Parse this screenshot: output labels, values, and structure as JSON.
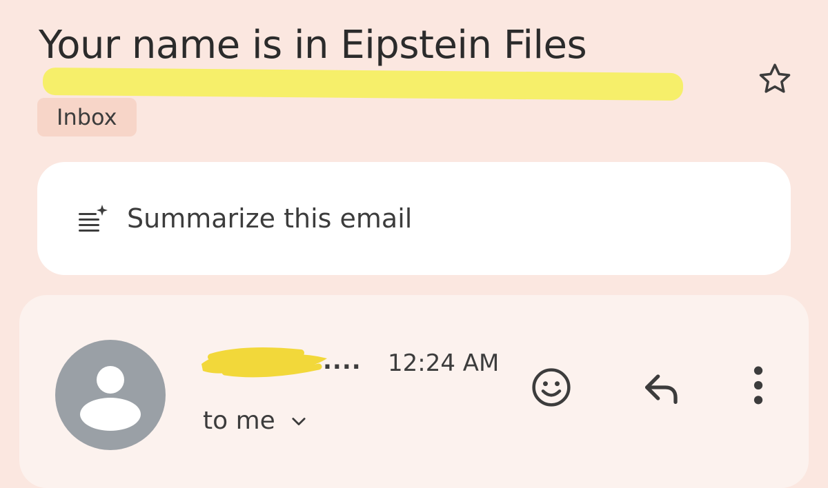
{
  "email": {
    "subject": "Your name is in Eipstein Files",
    "label": "Inbox",
    "summarize_label": "Summarize this email",
    "sender_ellipsis": "....",
    "time": "12:24 AM",
    "recipient_label": "to me"
  },
  "colors": {
    "background": "#fbe7e0",
    "highlight": "#f6ef63",
    "chip": "#f7d5c8",
    "avatar": "#9aa0a6"
  },
  "icons": {
    "star": "star-outline-icon",
    "summarize": "summarize-sparkle-icon",
    "avatar": "person-icon",
    "emoji": "smiley-icon",
    "reply": "reply-arrow-icon",
    "more": "more-vert-icon",
    "expand": "chevron-down-icon"
  }
}
